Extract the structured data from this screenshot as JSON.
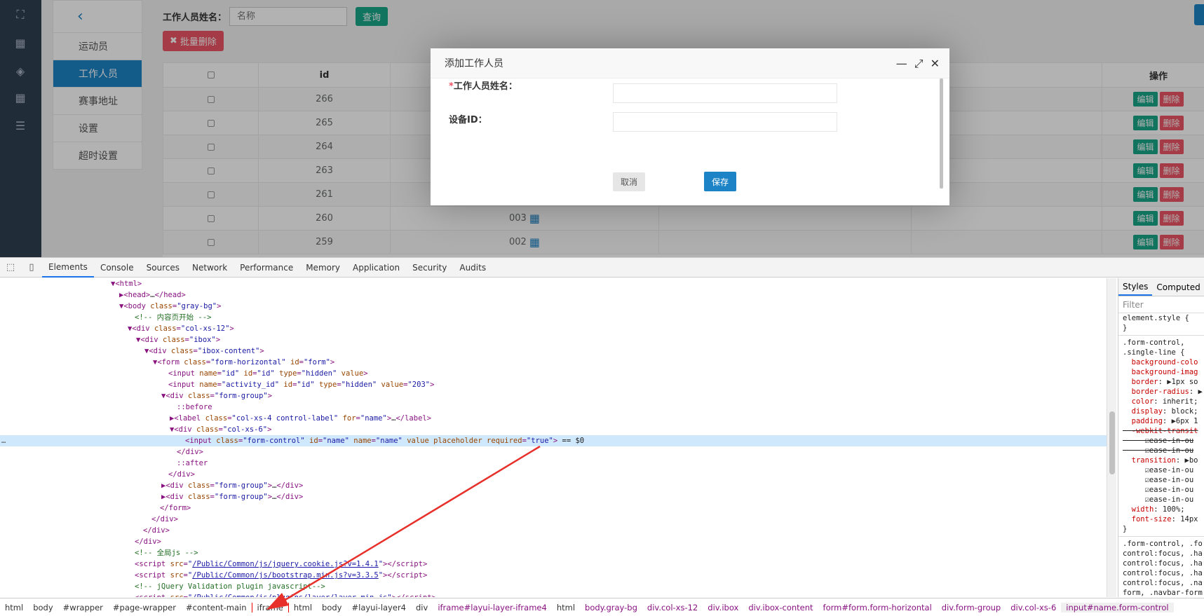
{
  "toolbar": {
    "name_label": "工作人员姓名：",
    "name_placeholder": "名称",
    "query_label": "查询",
    "batch_delete_label": "批量删除"
  },
  "subnav": {
    "items": [
      {
        "label": "运动员"
      },
      {
        "label": "工作人员"
      },
      {
        "label": "赛事地址"
      },
      {
        "label": "设置"
      },
      {
        "label": "超时设置"
      }
    ]
  },
  "table": {
    "headers": {
      "id": "id",
      "op": "操作"
    },
    "rows": [
      {
        "id": "266",
        "code": ""
      },
      {
        "id": "265",
        "code": ""
      },
      {
        "id": "264",
        "code": ""
      },
      {
        "id": "263",
        "code": ""
      },
      {
        "id": "261",
        "code": ""
      },
      {
        "id": "260",
        "code": "003"
      },
      {
        "id": "259",
        "code": "002"
      }
    ],
    "edit_label": "编辑",
    "delete_label": "删除"
  },
  "dialog": {
    "title": "添加工作人员",
    "field1_required": "*",
    "field1_label": "工作人员姓名：",
    "field2_label": "设备ID：",
    "cancel_label": "取消",
    "save_label": "保存"
  },
  "devtools": {
    "tabs": [
      "Elements",
      "Console",
      "Sources",
      "Network",
      "Performance",
      "Memory",
      "Application",
      "Security",
      "Audits"
    ],
    "styles_tabs": [
      "Styles",
      "Computed"
    ],
    "filter_placeholder": "Filter",
    "crumbs": [
      "html",
      "body",
      "#wrapper",
      "#page-wrapper",
      "#content-main",
      "iframe",
      "html",
      "body",
      "#layui-layer4",
      "div",
      "iframe#layui-layer-iframe4",
      "html",
      "body.gray-bg",
      "div.col-xs-12",
      "div.ibox",
      "div.ibox-content",
      "form#form.form-horizontal",
      "div.form-group",
      "div.col-xs-6",
      "input#name.form-control"
    ]
  },
  "colors": {
    "primary": "#1c84c6",
    "success": "#18a689",
    "danger": "#ed5565",
    "sidebar": "#2f4050"
  }
}
